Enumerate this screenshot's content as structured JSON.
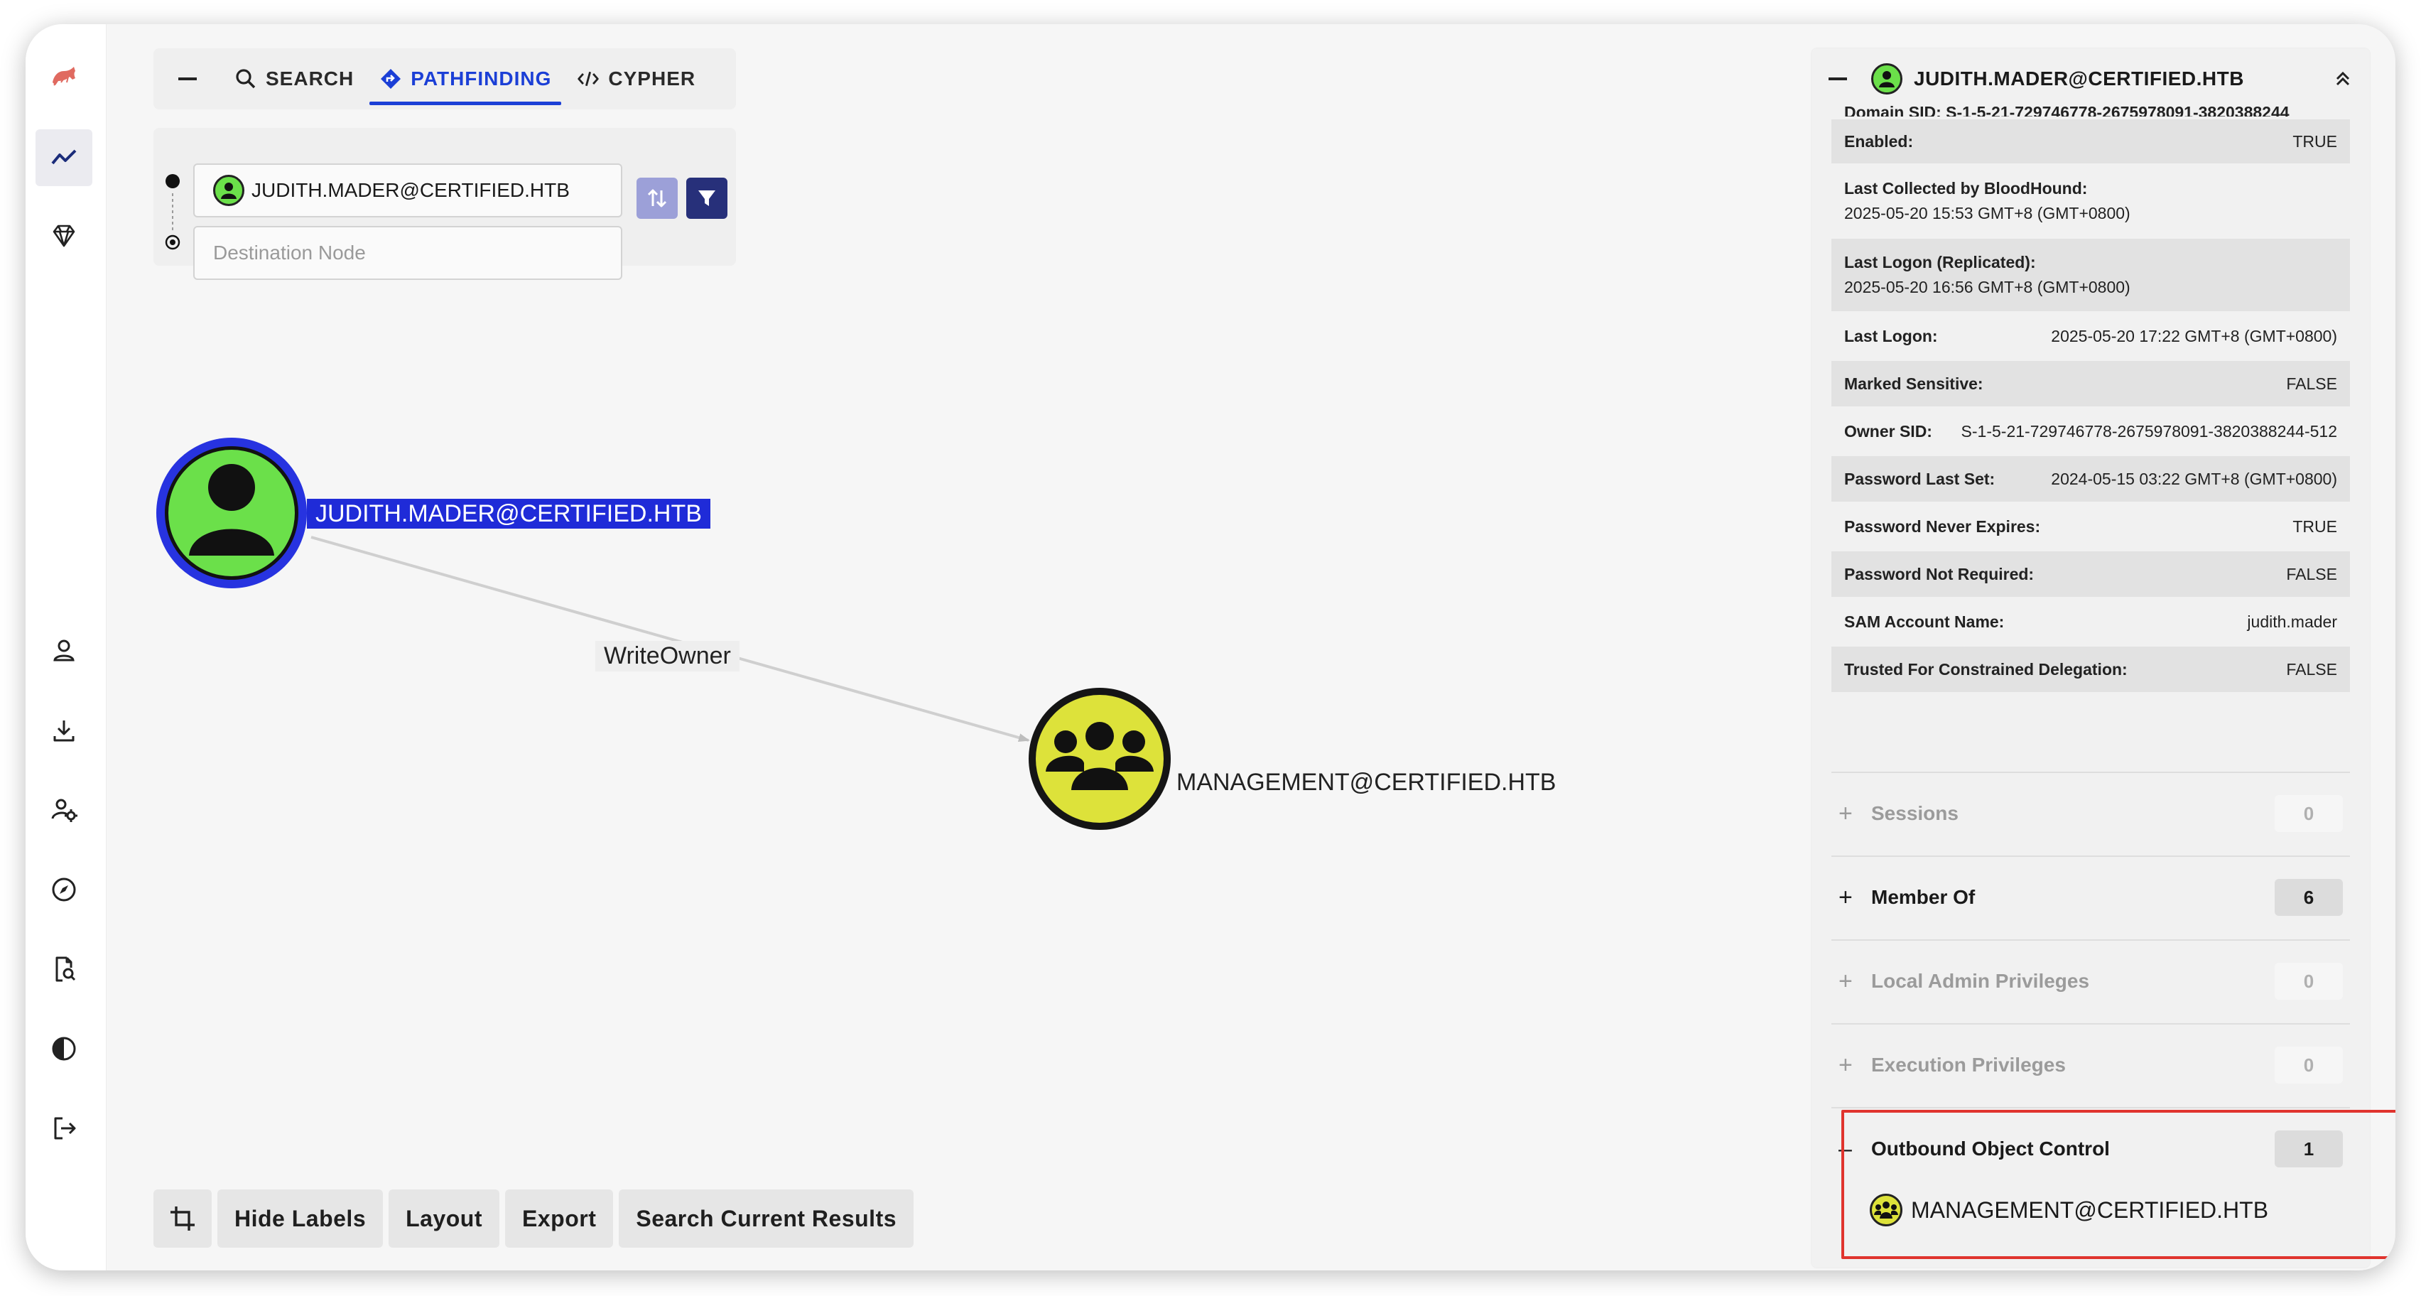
{
  "tabs": {
    "search": "SEARCH",
    "pathfinding": "PATHFINDING",
    "cypher": "CYPHER"
  },
  "pathfinding": {
    "source_value": "JUDITH.MADER@CERTIFIED.HTB",
    "destination_placeholder": "Destination Node"
  },
  "graph": {
    "source_node": "JUDITH.MADER@CERTIFIED.HTB",
    "target_node": "MANAGEMENT@CERTIFIED.HTB",
    "edge": "WriteOwner",
    "colors": {
      "user": "#6be04a",
      "group": "#dde23a",
      "selected": "#1f2bd8"
    }
  },
  "toolbar": {
    "hide_labels": "Hide Labels",
    "layout": "Layout",
    "export": "Export",
    "search_results": "Search Current Results"
  },
  "panel": {
    "title": "JUDITH.MADER@CERTIFIED.HTB",
    "cut_row": "Domain SID:   S-1-5-21-729746778-2675978091-3820388244",
    "properties": [
      {
        "key": "Enabled:",
        "value": "TRUE"
      },
      {
        "key": "Last Collected by BloodHound:",
        "value": "2025-05-20 15:53 GMT+8 (GMT+0800)"
      },
      {
        "key": "Last Logon (Replicated):",
        "value": "2025-05-20 16:56 GMT+8 (GMT+0800)"
      },
      {
        "key": "Last Logon:",
        "value": "2025-05-20 17:22 GMT+8 (GMT+0800)"
      },
      {
        "key": "Marked Sensitive:",
        "value": "FALSE"
      },
      {
        "key": "Owner SID:",
        "value": "S-1-5-21-729746778-2675978091-3820388244-512"
      },
      {
        "key": "Password Last Set:",
        "value": "2024-05-15 03:22 GMT+8 (GMT+0800)"
      },
      {
        "key": "Password Never Expires:",
        "value": "TRUE"
      },
      {
        "key": "Password Not Required:",
        "value": "FALSE"
      },
      {
        "key": "SAM Account Name:",
        "value": "judith.mader"
      },
      {
        "key": "Trusted For Constrained Delegation:",
        "value": "FALSE"
      }
    ],
    "sections": [
      {
        "name": "Sessions",
        "count": "0",
        "symbol": "+"
      },
      {
        "name": "Member Of",
        "count": "6",
        "symbol": "+"
      },
      {
        "name": "Local Admin Privileges",
        "count": "0",
        "symbol": "+"
      },
      {
        "name": "Execution Privileges",
        "count": "0",
        "symbol": "+"
      },
      {
        "name": "Outbound Object Control",
        "count": "1",
        "symbol": "–"
      }
    ],
    "outbound_item": "MANAGEMENT@CERTIFIED.HTB"
  }
}
